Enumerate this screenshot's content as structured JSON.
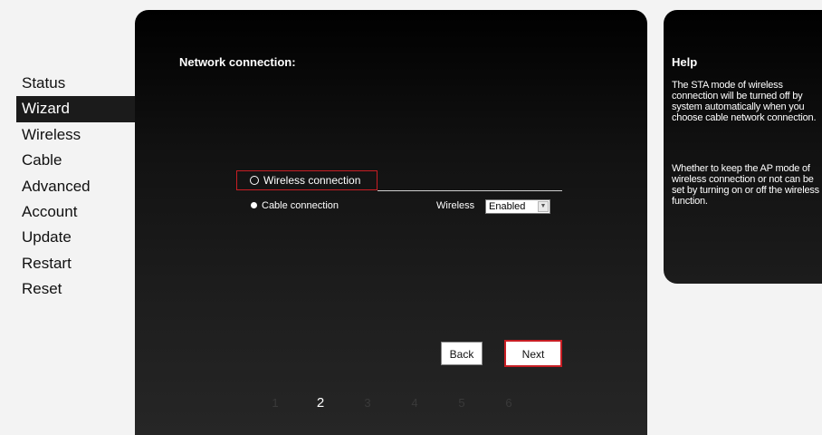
{
  "sidebar": {
    "items": [
      {
        "label": "Status"
      },
      {
        "label": "Wizard"
      },
      {
        "label": "Wireless"
      },
      {
        "label": "Cable"
      },
      {
        "label": "Advanced"
      },
      {
        "label": "Account"
      },
      {
        "label": "Update"
      },
      {
        "label": "Restart"
      },
      {
        "label": "Reset"
      }
    ],
    "active_label": "Wizard"
  },
  "main": {
    "title": "Network connection:",
    "options": {
      "wireless": "Wireless connection",
      "cable": "Cable connection",
      "selected": "wireless"
    },
    "wireless_label": "Wireless",
    "wireless_select": {
      "value": "Enabled"
    },
    "buttons": {
      "back": "Back",
      "next": "Next"
    },
    "steps": [
      "1",
      "2",
      "3",
      "4",
      "5",
      "6"
    ],
    "current_step": "2"
  },
  "help": {
    "title": "Help",
    "paragraph1": "The STA mode of wireless connection will be turned off by system automatically when you choose cable network connection.",
    "paragraph2": "Whether to keep the AP mode of wireless connection or not can be set by turning on or off the wireless function."
  },
  "colors": {
    "accent_red": "#c81e24",
    "panel_dark": "#000000",
    "page_background": "#f3f3f3"
  }
}
